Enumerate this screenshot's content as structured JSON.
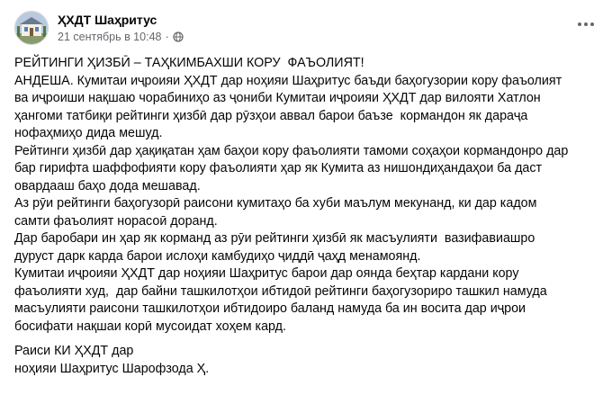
{
  "post": {
    "author": "ҲХДТ Шаҳритус",
    "timestamp": "21 сентябрь в 10:48",
    "separator": "·",
    "privacy_icon": "globe-icon",
    "more_icon": "more-options-icon",
    "body_lines": [
      "РЕЙТИНГИ ҲИЗБӢ – ТАҲКИМБАХШИ КОРУ  ФАЪОЛИЯТ!",
      "АНДЕША. Кумитаи иҷроияи ҲХДТ дар ноҳияи Шаҳритус баъди баҳогузории кору фаъолият",
      "ва иҷроиши нақшаю чорабиниҳо аз ҷониби Кумитаи иҷроияи ҲХДТ дар вилояти Хатлон",
      "ҳангоми татбиқи рейтинги ҳизбӣ дар рӯзҳои аввал барои баъзе  кормандон як дараҷа",
      "нофаҳмиҳо дида мешуд.",
      "Рейтинги ҳизбӣ дар ҳақиқатан ҳам баҳои кору фаъолияти тамоми соҳаҳои кормандонро дар",
      "бар гирифта шаффофияти кору фаъолияти ҳар як Кумита аз нишондиҳандаҳои ба даст",
      "овардааш баҳо дода мешавад.",
      "Аз рӯи рейтинги баҳогузорӣ раисони кумитаҳо ба хуби маълум мекунанд, ки дар кадом",
      "самти фаъолият норасоӣ доранд.",
      "Дар баробари ин ҳар як корманд аз рӯи рейтинги ҳизбӣ як масъулияти  вазифавиашро",
      "дуруст дарк карда барои ислоҳи камбудиҳо ҷиддӣ ҷаҳд менамоянд.",
      "Кумитаи иҷроияи ҲХДТ дар ноҳияи Шаҳритус барои дар оянда беҳтар кардани кору",
      "фаъолияти худ,  дар байни ташкилотҳои ибтидоӣ рейтинги баҳогузориро ташкил намуда",
      "масъулияти раисони ташкилотҳои ибтидоиро баланд намуда ба ин восита дар иҷрои",
      "босифати нақшаи корӣ мусоидат хоҳем кард."
    ],
    "signature_lines": [
      "Раиси КИ ҲХДТ дар",
      "ноҳияи Шаҳритус Шарофзода Ҳ."
    ]
  },
  "colors": {
    "text": "#050505",
    "secondary": "#65676b",
    "background": "#ffffff"
  }
}
